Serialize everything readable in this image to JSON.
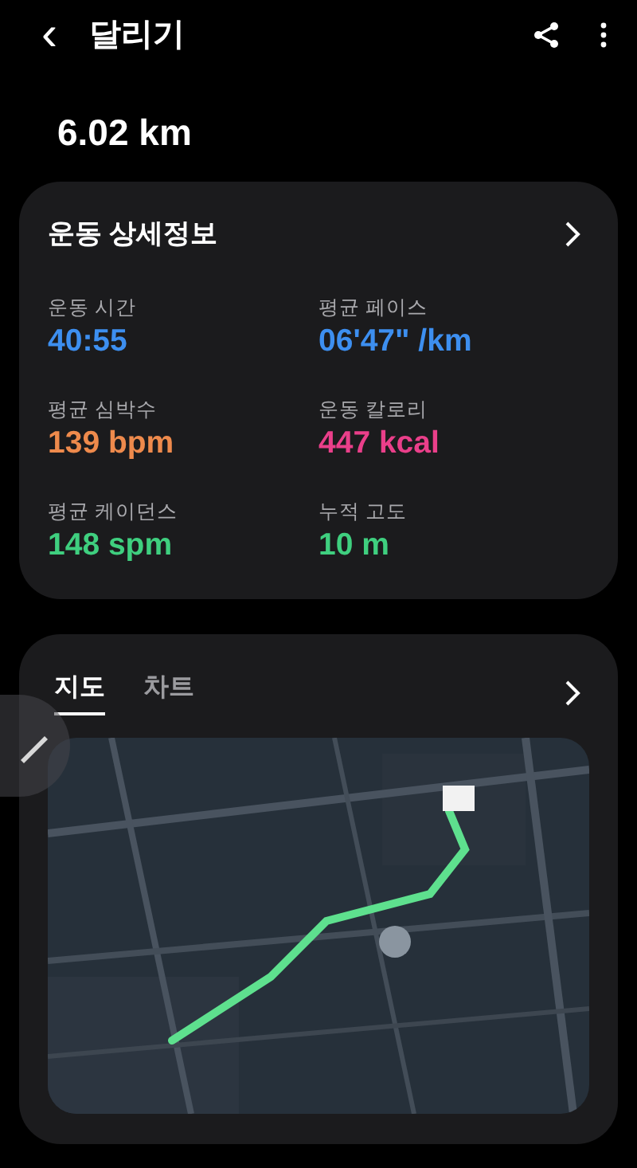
{
  "header": {
    "back": "‹",
    "title": "달리기"
  },
  "distance": "6.02 km",
  "details": {
    "title": "운동 상세정보",
    "stats": [
      {
        "label": "운동 시간",
        "value": "40:55",
        "color": "#3d8ff0"
      },
      {
        "label": "평균 페이스",
        "value": "06'47\" /km",
        "color": "#3d8ff0"
      },
      {
        "label": "평균 심박수",
        "value": "139 bpm",
        "color": "#ee8a4c"
      },
      {
        "label": "운동 칼로리",
        "value": "447 kcal",
        "color": "#ea3f8a"
      },
      {
        "label": "평균 케이던스",
        "value": "148 spm",
        "color": "#3fcf7f"
      },
      {
        "label": "누적 고도",
        "value": "10 m",
        "color": "#3fcf7f"
      }
    ]
  },
  "tabs": [
    {
      "label": "지도",
      "selected": true
    },
    {
      "label": "차트",
      "selected": false
    }
  ]
}
